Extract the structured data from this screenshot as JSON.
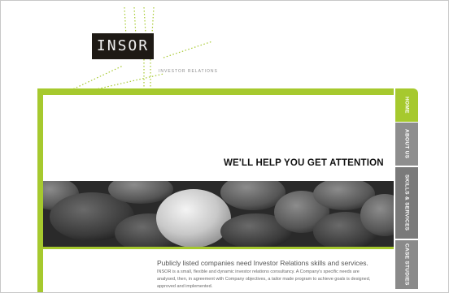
{
  "brand": {
    "logo_text": "INSOR",
    "tagline": "INVESTOR RELATIONS"
  },
  "nav": {
    "tabs": [
      {
        "label": "HOME",
        "active": true
      },
      {
        "label": "ABOUT US",
        "active": false
      },
      {
        "label": "SKILLS & SERVICES",
        "active": false
      },
      {
        "label": "CASE STUDIES",
        "active": false
      }
    ]
  },
  "hero": {
    "headline": "WE'LL HELP YOU GET ATTENTION",
    "image": "grey-stones-photo"
  },
  "body": {
    "title": "Publicly listed companies need Investor Relations skills and services.",
    "text": "INSOR is a small, flexible and dynamic investor relations consultancy. A Company's specific needs are analysed, then, in agreement with Company objectives, a tailor made program to achieve goals is designed, approved and implemented."
  },
  "colors": {
    "accent": "#a6c92e",
    "logo_bg": "#1e1a15",
    "tab_grey": "#8a8a8a"
  }
}
